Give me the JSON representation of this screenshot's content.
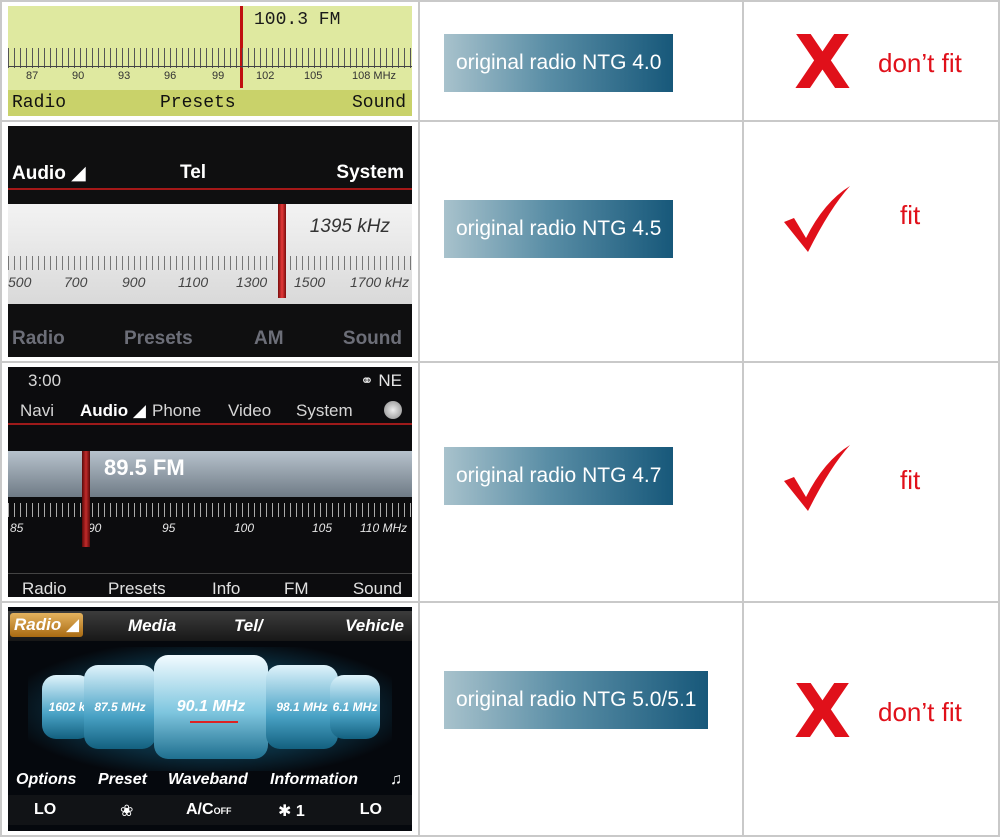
{
  "rows": [
    {
      "screen": {
        "frequency": "100.3 FM",
        "scale": [
          "87",
          "90",
          "93",
          "96",
          "99",
          "102",
          "105",
          "108 MHz"
        ],
        "menu": [
          "Radio",
          "Presets",
          "Sound"
        ]
      },
      "badge": "original radio NTG 4.0",
      "mark": "X",
      "verdict": "don’t fit"
    },
    {
      "screen": {
        "top_menu": [
          "Audio ◢",
          "Tel",
          "System"
        ],
        "frequency": "1395 kHz",
        "scale": [
          "500",
          "700",
          "900",
          "1100",
          "1300",
          "1500",
          "1700 kHz"
        ],
        "bottom_menu": [
          "Radio",
          "Presets",
          "AM",
          "Sound"
        ]
      },
      "badge": "original radio NTG 4.5",
      "mark": "check",
      "verdict": "fit"
    },
    {
      "screen": {
        "time": "3:00",
        "compass": "NE",
        "nav": [
          "Navi",
          "Audio ◢",
          "Phone",
          "Video",
          "System"
        ],
        "frequency": "89.5 FM",
        "scale": [
          "85",
          "90",
          "95",
          "100",
          "105",
          "110 MHz"
        ],
        "bottom_menu": [
          "Radio",
          "Presets",
          "Info",
          "FM",
          "Sound"
        ]
      },
      "badge": "original radio NTG 4.7",
      "mark": "check",
      "verdict": "fit"
    },
    {
      "screen": {
        "tabs": [
          "Radio ◢",
          "Media",
          "Tel/",
          "Vehicle"
        ],
        "stations": [
          "1602 k",
          "87.5 MHz",
          "90.1 MHz",
          "98.1 MHz",
          "6.1 MHz"
        ],
        "menu": [
          "Options",
          "Preset",
          "Waveband",
          "Information"
        ],
        "climate": [
          "LO",
          "❀",
          "A/C",
          "OFF",
          "✱ 1",
          "LO"
        ]
      },
      "badge": "original radio NTG 5.0/5.1",
      "mark": "X",
      "verdict": "don’t fit"
    }
  ],
  "colors": {
    "verdict": "#e0101a",
    "badge_start": "#a8c2cc",
    "badge_end": "#17587a",
    "border": "#c9c9c9"
  }
}
